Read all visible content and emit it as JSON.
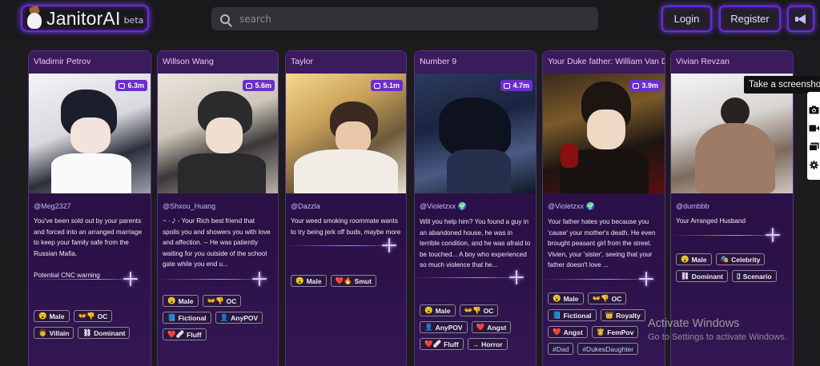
{
  "header": {
    "logo_text": "JanitorAI",
    "logo_badge": "beta",
    "search_placeholder": "search",
    "login_label": "Login",
    "register_label": "Register",
    "announce_icon": "megaphone-icon"
  },
  "cards": [
    {
      "name": "Vladimir Petrov",
      "count": "6.3m",
      "creator": "@Meg2327",
      "description": "You've been sold out by your parents and forced into an arranged marriage to keep your family safe from the Russian Mafia.\n\nPotential CNC warning",
      "tags": [
        [
          "😮",
          "Male"
        ],
        [
          "👐👎",
          "OC"
        ],
        [
          "👨",
          "Villain"
        ],
        [
          "⛓",
          "Dominant"
        ]
      ]
    },
    {
      "name": "Willson Wang",
      "count": "5.6m",
      "creator": "@Shxou_Huang",
      "description": "~ · 𝅘𝅥𝅮 - Your Rich best friend that spoils you and showers you with love and affection. -- He was patiently waiting for you outside of the school gate while you end u...",
      "tags": [
        [
          "😮",
          "Male"
        ],
        [
          "👐👎",
          "OC"
        ],
        [
          "📘",
          "Fictional"
        ],
        [
          "👤",
          "AnyPOV"
        ],
        [
          "❤️🩹",
          "Fluff"
        ]
      ]
    },
    {
      "name": "Taylor",
      "count": "5.1m",
      "creator": "@Dazzla",
      "description": "Your weed smoking roommate wants to try being jerk off buds, maybe more",
      "tags": [
        [
          "😮",
          "Male"
        ],
        [
          "❤️🔥",
          "Smut"
        ]
      ]
    },
    {
      "name": "Number 9",
      "count": "4.7m",
      "creator": "@Violetzxx 🌍",
      "description": "Will you help him? You found a guy in an abandoned house, he was in terrible condition, and he was afraid to be touched... A boy who experienced so much violence that he...",
      "tags": [
        [
          "😮",
          "Male"
        ],
        [
          "👐👎",
          "OC"
        ],
        [
          "👤",
          "AnyPOV"
        ],
        [
          "❤️",
          "Angst"
        ],
        [
          "❤️🩹",
          "Fluff"
        ],
        [
          "→",
          "Horror"
        ]
      ]
    },
    {
      "name": "Your Duke father: William Van D",
      "count": "3.9m",
      "creator": "@Violetzxx 🌍",
      "description": "Your father hates you because you 'cause' your mother's death. He even brought peasant girl from the street. Vivien, your 'sister', seeing that your father doesn't love ...",
      "tags": [
        [
          "😮",
          "Male"
        ],
        [
          "👐👎",
          "OC"
        ],
        [
          "📘",
          "Fictional"
        ],
        [
          "👑",
          "Royalty"
        ],
        [
          "❤️",
          "Angst"
        ],
        [
          "👸",
          "FemPov"
        ],
        [
          "",
          "#Dad"
        ],
        [
          "",
          "#DukesDaughter"
        ]
      ]
    },
    {
      "name": "Vivian Revzan",
      "count": "",
      "creator": "@dumbbb",
      "description": "Your Arranged Husband",
      "tags": [
        [
          "😮",
          "Male"
        ],
        [
          "🎭",
          "Celebrity"
        ],
        [
          "⛓",
          "Dominant"
        ],
        [
          "▯",
          "Scenario"
        ]
      ]
    }
  ],
  "tooltip": "Take a screenshot",
  "side_tools": [
    "screenshot-icon",
    "video-icon",
    "window-icon",
    "settings-icon"
  ],
  "watermark": {
    "line1": "Activate Windows",
    "line2": "Go to Settings to activate Windows."
  },
  "colors": {
    "accent": "#6a2bd9",
    "card_bg": "#2a1045",
    "badge": "#6b2fc9"
  }
}
